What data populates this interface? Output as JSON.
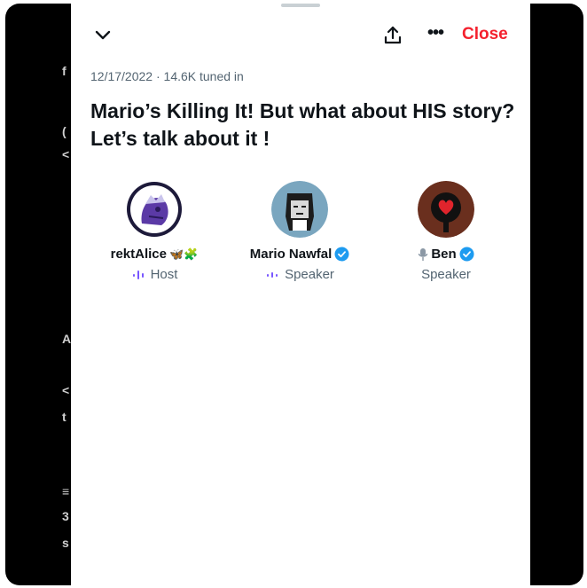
{
  "header": {
    "close_label": "Close",
    "more_label": "•••"
  },
  "space": {
    "date": "12/17/2022",
    "separator": " · ",
    "tuned_in": "14.6K tuned in",
    "title": "Mario’s Killing It! But what about HIS story? Let’s talk about it !"
  },
  "participants": [
    {
      "name": "rektAlice",
      "role": "Host",
      "emoji": "🦋🧩"
    },
    {
      "name": "Mario Nawfal",
      "role": "Speaker",
      "verified": true
    },
    {
      "name": "Ben",
      "role": "Speaker",
      "verified": true
    }
  ],
  "colors": {
    "close": "#f4212e",
    "verified": "#1d9bf0",
    "speaking": "#7856ff",
    "text": "#0f1419",
    "secondary": "#536471"
  }
}
